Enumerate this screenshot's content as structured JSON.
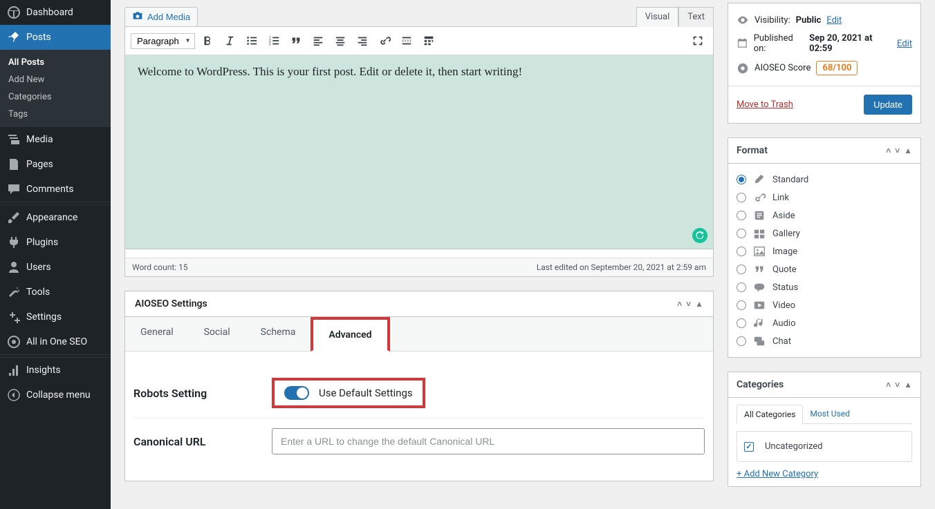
{
  "sidebar": {
    "dashboard": "Dashboard",
    "posts": "Posts",
    "posts_sub": {
      "all": "All Posts",
      "add": "Add New",
      "cats": "Categories",
      "tags": "Tags"
    },
    "media": "Media",
    "pages": "Pages",
    "comments": "Comments",
    "appearance": "Appearance",
    "plugins": "Plugins",
    "users": "Users",
    "tools": "Tools",
    "settings": "Settings",
    "aioseo": "All in One SEO",
    "insights": "Insights",
    "collapse": "Collapse menu"
  },
  "editor": {
    "add_media": "Add Media",
    "tab_visual": "Visual",
    "tab_text": "Text",
    "format_select": "Paragraph",
    "content": "Welcome to WordPress. This is your first post. Edit or delete it, then start writing!",
    "word_count": "Word count: 15",
    "last_edited": "Last edited on September 20, 2021 at 2:59 am"
  },
  "aioseo": {
    "title": "AIOSEO Settings",
    "tabs": {
      "general": "General",
      "social": "Social",
      "schema": "Schema",
      "advanced": "Advanced"
    },
    "robots_label": "Robots Setting",
    "robots_toggle_label": "Use Default Settings",
    "canonical_label": "Canonical URL",
    "canonical_placeholder": "Enter a URL to change the default Canonical URL"
  },
  "publish": {
    "visibility_label": "Visibility:",
    "visibility_value": "Public",
    "visibility_edit": "Edit",
    "published_label": "Published on:",
    "published_value": "Sep 20, 2021 at 02:59",
    "published_edit": "Edit",
    "score_label": "AIOSEO Score",
    "score_value": "68/100",
    "trash": "Move to Trash",
    "update": "Update"
  },
  "format_box": {
    "title": "Format",
    "items": [
      "Standard",
      "Link",
      "Aside",
      "Gallery",
      "Image",
      "Quote",
      "Status",
      "Video",
      "Audio",
      "Chat"
    ],
    "selected": "Standard"
  },
  "categories": {
    "title": "Categories",
    "tab_all": "All Categories",
    "tab_most": "Most Used",
    "item": "Uncategorized",
    "add_new": "+ Add New Category"
  }
}
